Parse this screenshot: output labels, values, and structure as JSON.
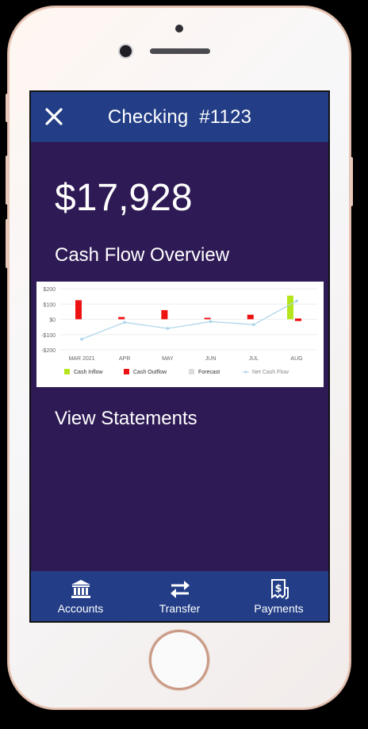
{
  "header": {
    "account_name": "Checking",
    "account_number": "#1123"
  },
  "balance": "$17,928",
  "cash_flow_title": "Cash Flow Overview",
  "view_statements_label": "View Statements",
  "tabs": [
    {
      "label": "Accounts",
      "icon": "bank-icon"
    },
    {
      "label": "Transfer",
      "icon": "transfer-arrows-icon"
    },
    {
      "label": "Payments",
      "icon": "receipt-dollar-icon"
    }
  ],
  "colors": {
    "header": "#233e86",
    "screen_bg": "#2e1a55",
    "inflow": "#b5e61d",
    "outflow": "#ee1111",
    "forecast": "#dddddd",
    "net": "#a9d3e8"
  },
  "chart_data": {
    "type": "bar",
    "categories": [
      "MAR 2021",
      "APR",
      "MAY",
      "JUN",
      "JUL",
      "AUG"
    ],
    "y_ticks": [
      "$200",
      "$100",
      "$0",
      "-$100",
      "-$200"
    ],
    "ylim": [
      -200,
      200
    ],
    "grid": true,
    "legend_position": "bottom",
    "series": [
      {
        "name": "Cash Inflow",
        "type": "bar",
        "values": [
          0,
          0,
          0,
          0,
          0,
          155
        ]
      },
      {
        "name": "Cash Outflow",
        "type": "bar",
        "values": [
          125,
          15,
          60,
          10,
          30,
          25
        ]
      },
      {
        "name": "Forecast",
        "type": "bar",
        "values": []
      },
      {
        "name": "Net Cash Flow",
        "type": "line",
        "values": [
          -130,
          -20,
          -60,
          -15,
          -35,
          120
        ]
      }
    ]
  }
}
